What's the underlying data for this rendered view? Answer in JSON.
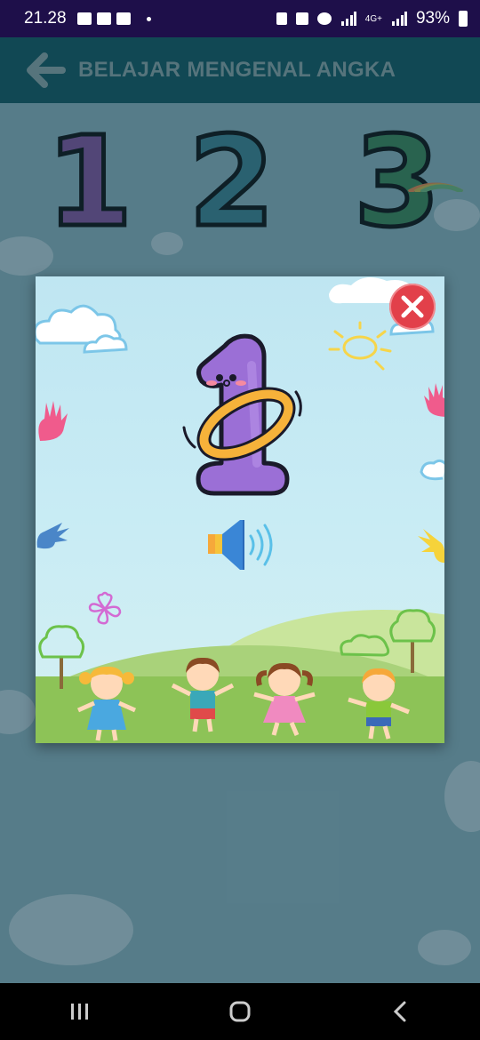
{
  "status_bar": {
    "time": "21.28",
    "network": "4G+",
    "battery": "93%"
  },
  "app_bar": {
    "title": "BELAJAR MENGENAL ANGKA",
    "back_icon": "arrow-left-icon"
  },
  "background_numbers": [
    "1",
    "2",
    "3"
  ],
  "dialog": {
    "close_icon": "close-icon",
    "number_icon": "number-one-character",
    "sound_icon": "speaker-icon"
  },
  "colors": {
    "status_bar": "#1e0f4a",
    "app_bar": "#0d4a57",
    "close_button": "#e2404a",
    "number_purple": "#9b6fd6"
  }
}
